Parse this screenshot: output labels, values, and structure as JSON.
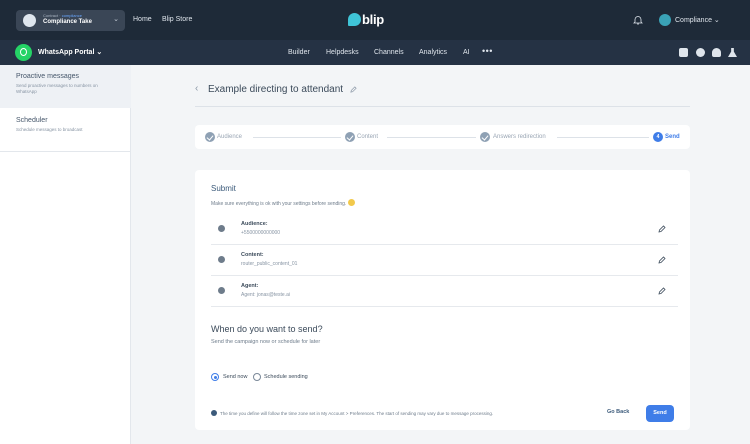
{
  "header": {
    "contract_label": "Contract",
    "contract_id": "compliance",
    "contract_name": "Compliance Take",
    "nav_home": "Home",
    "nav_store": "Blip Store",
    "logo": "blip",
    "account_name": "Compliance"
  },
  "portal": {
    "name": "WhatsApp Portal",
    "tabs": [
      "Builder",
      "Helpdesks",
      "Channels",
      "Analytics",
      "AI"
    ]
  },
  "sidebar": {
    "items": [
      {
        "title": "Proactive messages",
        "desc": "Send proactive messages to numbers on WhatsApp"
      },
      {
        "title": "Scheduler",
        "desc": "Schedule messages to broadcast"
      }
    ]
  },
  "page": {
    "title": "Example directing to attendant"
  },
  "stepper": {
    "steps": [
      {
        "label": "Audience",
        "state": "done"
      },
      {
        "label": "Content",
        "state": "done"
      },
      {
        "label": "Answers redirection",
        "state": "done"
      },
      {
        "label": "Send",
        "state": "current",
        "number": "4"
      }
    ]
  },
  "submit": {
    "title": "Submit",
    "subtitle": "Make sure everything is ok with your settings before sending.",
    "rows": [
      {
        "label": "Audience:",
        "value": "+5500000000000"
      },
      {
        "label": "Content:",
        "value": "router_public_content_01"
      },
      {
        "label": "Agent:",
        "value": "Agent: jonas@teste.ai"
      }
    ]
  },
  "when": {
    "title": "When do you want to send?",
    "subtitle": "Send the campaign now or schedule for later",
    "options": [
      "Send now",
      "Schedule sending"
    ],
    "selected": "Send now"
  },
  "footer": {
    "info": "The time you define will follow the time zone set in My Account > Preferences. The start of sending may vary due to message processing.",
    "back_label": "Go Back",
    "send_label": "Send"
  },
  "colors": {
    "topbar": "#1e2a38",
    "navbar": "#253244",
    "accent": "#3f7de8",
    "logo": "#3fc4d7"
  }
}
